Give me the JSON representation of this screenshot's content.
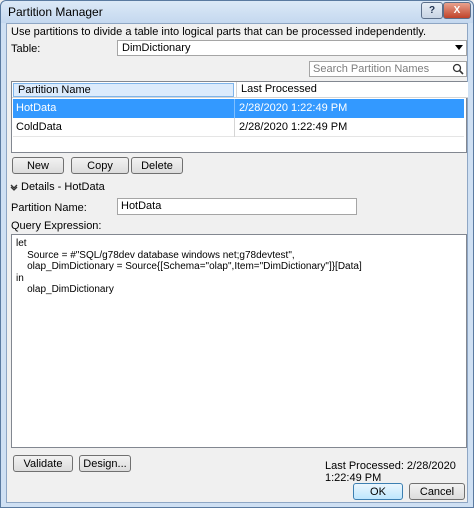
{
  "window": {
    "title": "Partition Manager",
    "help_glyph": "?",
    "close_glyph": "X"
  },
  "description": "Use partitions to divide a table into logical parts that can be processed independently.",
  "table_selector": {
    "label": "Table:",
    "selected": "DimDictionary"
  },
  "search": {
    "placeholder": "Search Partition Names",
    "icon": "search-icon"
  },
  "partitions": {
    "columns": [
      "Partition Name",
      "Last Processed"
    ],
    "rows": [
      {
        "name": "HotData",
        "last_processed": "2/28/2020 1:22:49 PM",
        "selected": true
      },
      {
        "name": "ColdData",
        "last_processed": "2/28/2020 1:22:49 PM",
        "selected": false
      }
    ]
  },
  "actions": {
    "new_label": "New",
    "copy_label": "Copy",
    "delete_label": "Delete"
  },
  "details": {
    "header": "Details - HotData",
    "partition_name_label": "Partition Name:",
    "partition_name_value": "HotData",
    "query_label": "Query Expression:",
    "query_text": "let\n    Source = #\"SQL/g78dev database windows net;g78devtest\",\n    olap_DimDictionary = Source{[Schema=\"olap\",Item=\"DimDictionary\"]}[Data]\nin\n    olap_DimDictionary"
  },
  "footer": {
    "validate_label": "Validate",
    "design_label": "Design...",
    "last_processed": "Last Processed: 2/28/2020 1:22:49 PM",
    "ok_label": "OK",
    "cancel_label": "Cancel"
  },
  "colors": {
    "selection": "#3399ff",
    "title_bar": "#c4d8ef",
    "close_button": "#c0432a"
  }
}
